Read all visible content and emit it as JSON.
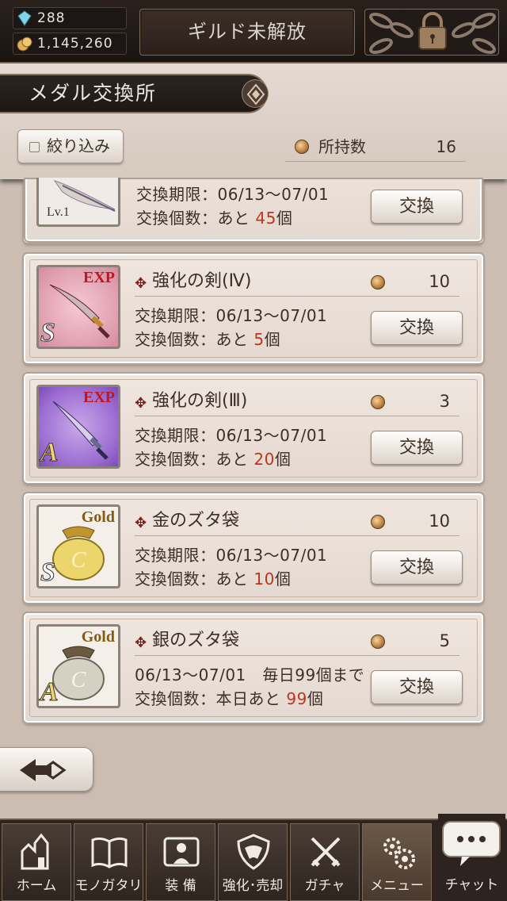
{
  "top_bar": {
    "gems": "288",
    "gold": "1,145,260",
    "guild_button": "ギルド未解放"
  },
  "header": {
    "title": "メダル交換所",
    "filter_label": "絞り込み",
    "owned_label": "所持数",
    "owned_count": "16"
  },
  "items": [
    {
      "level": "Lv.1",
      "period_line": "交換期限：06/13～07/01",
      "remaining_prefix": "交換個数：あと",
      "remaining": "45",
      "remaining_suffix": "個",
      "button": "交換"
    },
    {
      "name": "強化の剣(Ⅳ)",
      "cost": "10",
      "tag": "EXP",
      "rank": "S",
      "period_line": "交換期限：06/13～07/01",
      "remaining_prefix": "交換個数：あと",
      "remaining": "5",
      "remaining_suffix": "個",
      "button": "交換"
    },
    {
      "name": "強化の剣(Ⅲ)",
      "cost": "3",
      "tag": "EXP",
      "rank": "A",
      "period_line": "交換期限：06/13～07/01",
      "remaining_prefix": "交換個数：あと",
      "remaining": "20",
      "remaining_suffix": "個",
      "button": "交換"
    },
    {
      "name": "金のズタ袋",
      "cost": "10",
      "tag": "Gold",
      "rank": "S",
      "period_line": "交換期限：06/13～07/01",
      "remaining_prefix": "交換個数：あと",
      "remaining": "10",
      "remaining_suffix": "個",
      "button": "交換"
    },
    {
      "name": "銀のズタ袋",
      "cost": "5",
      "tag": "Gold",
      "rank": "A",
      "period_line": "06/13～07/01　毎日99個まで",
      "remaining_prefix": "交換個数：本日あと",
      "remaining": "99",
      "remaining_suffix": "個",
      "button": "交換"
    }
  ],
  "nav": [
    {
      "label": "ホーム",
      "icon": "castle-icon"
    },
    {
      "label": "モノガタリ",
      "icon": "book-icon"
    },
    {
      "label": "装 備",
      "icon": "equipment-icon"
    },
    {
      "label": "強化･売却",
      "icon": "shield-icon"
    },
    {
      "label": "ガチャ",
      "icon": "swords-icon"
    },
    {
      "label": "メニュー",
      "icon": "gears-icon"
    },
    {
      "label": "チャット",
      "icon": "chat-bubble-icon"
    }
  ],
  "colors": {
    "accent_red": "#c3331c",
    "panel": "#e8ddd5",
    "dark": "#2a211c"
  }
}
